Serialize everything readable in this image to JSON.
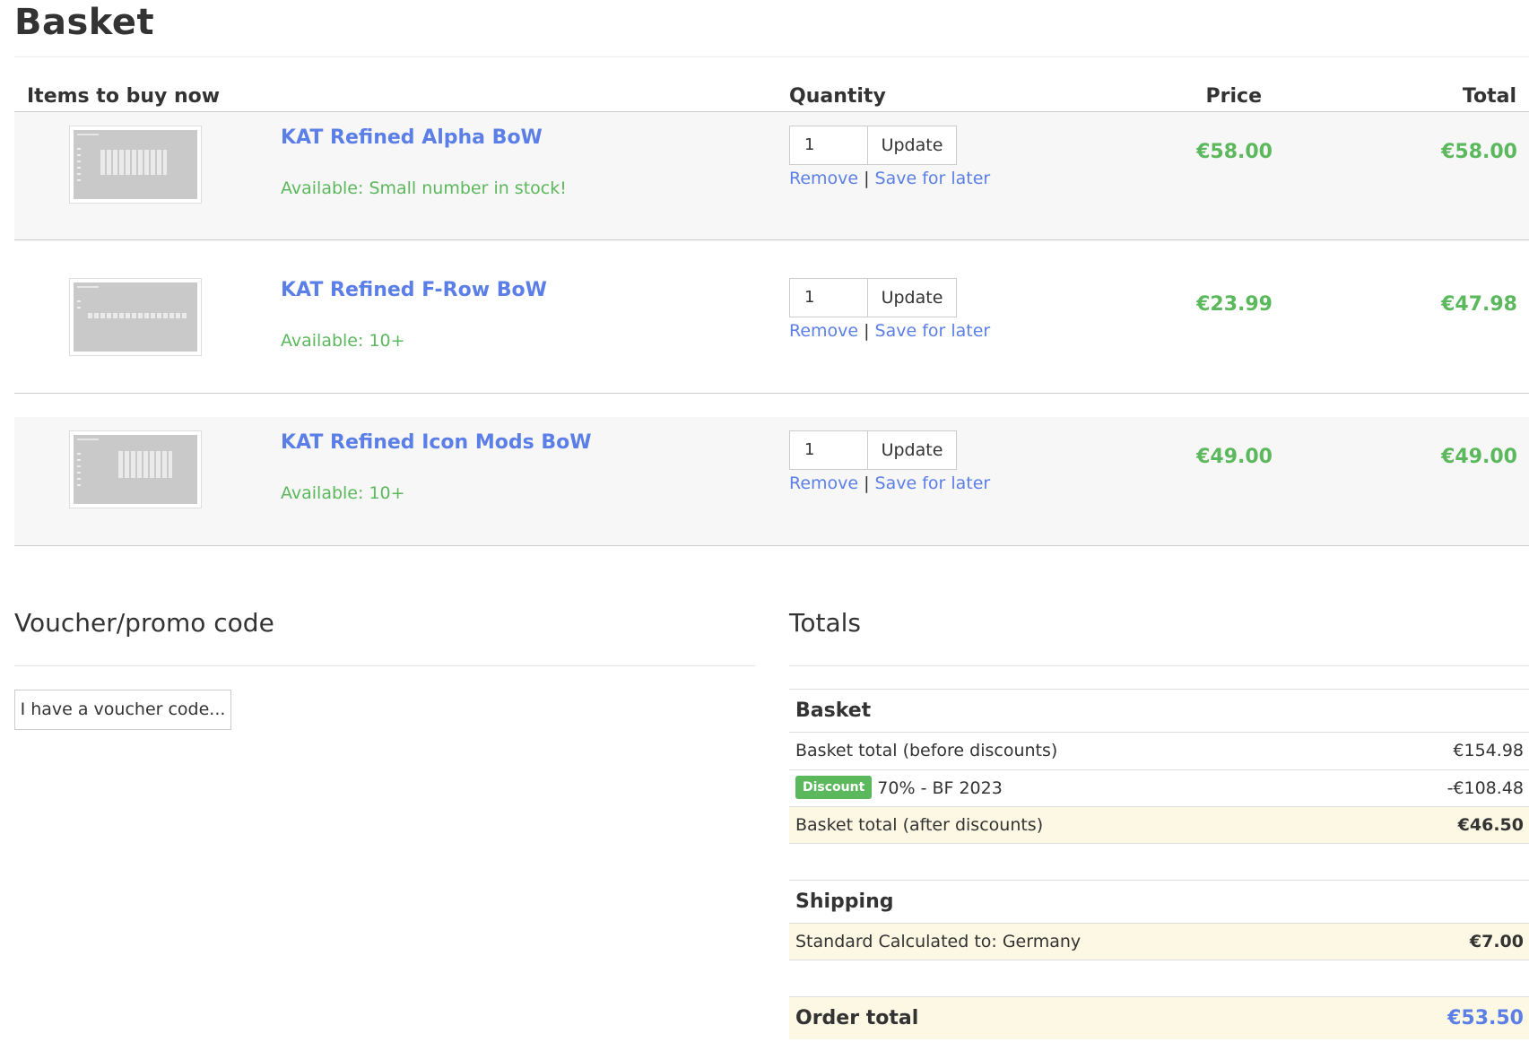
{
  "page": {
    "title": "Basket"
  },
  "table_headers": {
    "items": "Items to buy now",
    "quantity": "Quantity",
    "price": "Price",
    "total": "Total"
  },
  "items": [
    {
      "name": "KAT Refined Alpha BoW",
      "availability": "Available: Small number in stock!",
      "quantity": "1",
      "price": "€58.00",
      "total": "€58.00"
    },
    {
      "name": "KAT Refined F-Row BoW",
      "availability": "Available: 10+",
      "quantity": "1",
      "price": "€23.99",
      "total": "€47.98"
    },
    {
      "name": "KAT Refined Icon Mods BoW",
      "availability": "Available: 10+",
      "quantity": "1",
      "price": "€49.00",
      "total": "€49.00"
    }
  ],
  "item_actions": {
    "update": "Update",
    "remove": "Remove",
    "separator": "|",
    "save_for_later": "Save for later"
  },
  "voucher": {
    "title": "Voucher/promo code",
    "button": "I have a voucher code..."
  },
  "totals": {
    "title": "Totals",
    "basket_heading": "Basket",
    "before_discounts_label": "Basket total (before discounts)",
    "before_discounts_value": "€154.98",
    "discount_badge": "Discount",
    "discount_label": "70% - BF 2023",
    "discount_value": "-€108.48",
    "after_discounts_label": "Basket total (after discounts)",
    "after_discounts_value": "€46.50",
    "shipping_heading": "Shipping",
    "shipping_label": "Standard Calculated to: Germany",
    "shipping_value": "€7.00",
    "order_total_label": "Order total",
    "order_total_value": "€53.50"
  },
  "colors": {
    "link": "#5b7fe6",
    "success": "#5cb85c",
    "highlight": "#fcf8e3",
    "row_shade": "#f7f7f7"
  }
}
